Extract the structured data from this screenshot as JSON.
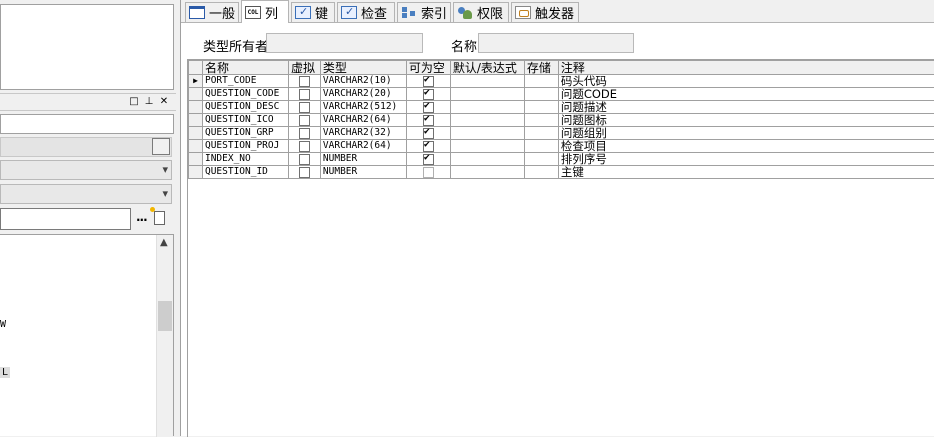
{
  "tabs": [
    {
      "label": "一般",
      "icon": "general-icon"
    },
    {
      "label": "列",
      "icon": "column-icon",
      "icon_text": "COL",
      "active": true
    },
    {
      "label": "键",
      "icon": "key-icon"
    },
    {
      "label": "检查",
      "icon": "check-icon"
    },
    {
      "label": "索引",
      "icon": "index-icon"
    },
    {
      "label": "权限",
      "icon": "privilege-icon"
    },
    {
      "label": "触发器",
      "icon": "trigger-icon"
    }
  ],
  "fields": {
    "owner_label": "类型所有者",
    "owner_value": "",
    "name_label": "名称",
    "name_value": ""
  },
  "grid": {
    "headers": [
      "名称",
      "虚拟",
      "类型",
      "可为空",
      "默认/表达式",
      "存储",
      "注释"
    ],
    "rows": [
      {
        "name": "PORT_CODE",
        "virtual": false,
        "type": "VARCHAR2(10)",
        "nullable": true,
        "default": "",
        "storage": "",
        "comment": "码头代码",
        "current": true
      },
      {
        "name": "QUESTION_CODE",
        "virtual": false,
        "type": "VARCHAR2(20)",
        "nullable": true,
        "default": "",
        "storage": "",
        "comment": "问题CODE"
      },
      {
        "name": "QUESTION_DESC",
        "virtual": false,
        "type": "VARCHAR2(512)",
        "nullable": true,
        "default": "",
        "storage": "",
        "comment": "问题描述"
      },
      {
        "name": "QUESTION_ICO",
        "virtual": false,
        "type": "VARCHAR2(64)",
        "nullable": true,
        "default": "",
        "storage": "",
        "comment": "问题图标"
      },
      {
        "name": "QUESTION_GRP",
        "virtual": false,
        "type": "VARCHAR2(32)",
        "nullable": true,
        "default": "",
        "storage": "",
        "comment": "问题组别"
      },
      {
        "name": "QUESTION_PROJ",
        "virtual": false,
        "type": "VARCHAR2(64)",
        "nullable": true,
        "default": "",
        "storage": "",
        "comment": "检查项目"
      },
      {
        "name": "INDEX_NO",
        "virtual": false,
        "type": "NUMBER",
        "nullable": true,
        "default": "",
        "storage": "",
        "comment": "排列序号"
      },
      {
        "name": "QUESTION_ID",
        "virtual": false,
        "type": "NUMBER",
        "nullable": false,
        "default": "",
        "storage": "",
        "comment": "主键"
      }
    ]
  },
  "left_panel": {
    "browse_label": "...",
    "tree_fragments": [
      "W",
      "L"
    ]
  }
}
